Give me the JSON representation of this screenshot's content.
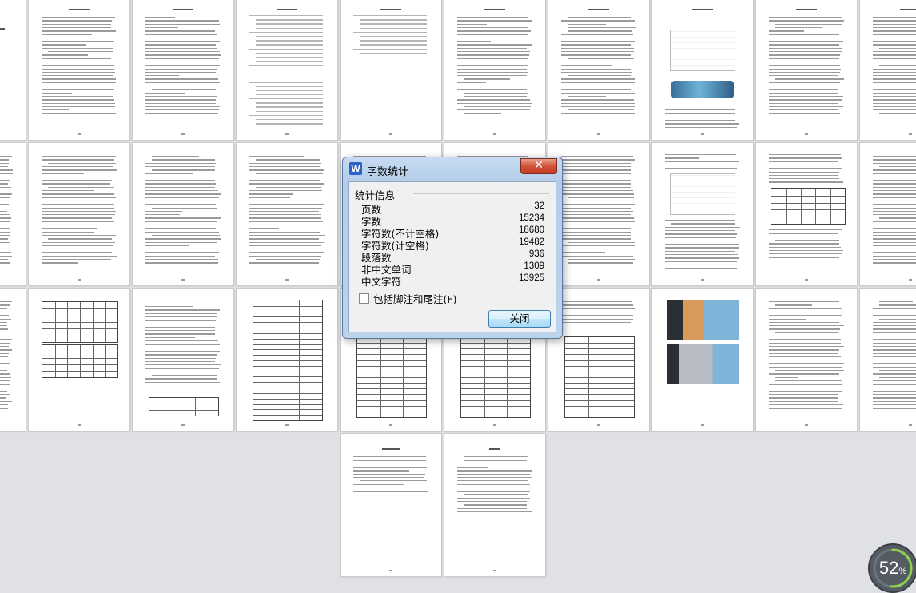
{
  "dialog": {
    "title": "字数统计",
    "app_icon_letter": "W",
    "close_glyph": "✕",
    "group_title": "统计信息",
    "stats": [
      {
        "label": "页数",
        "value": "32"
      },
      {
        "label": "字数",
        "value": "15234"
      },
      {
        "label": "字符数(不计空格)",
        "value": "18680"
      },
      {
        "label": "字符数(计空格)",
        "value": "19482"
      },
      {
        "label": "段落数",
        "value": "936"
      },
      {
        "label": "非中文单词",
        "value": "1309"
      },
      {
        "label": "中文字符",
        "value": "13925"
      }
    ],
    "include_footnotes_label": "包括脚注和尾注(F)",
    "include_footnotes_checked": false,
    "close_button_label": "关闭"
  },
  "zoom": {
    "value": "52",
    "unit": "%",
    "ring_fraction": 0.52
  },
  "theme": {
    "background": "#dfe1e4",
    "dialog_accent": "#2a63c3",
    "close_red": "#c13b22"
  }
}
